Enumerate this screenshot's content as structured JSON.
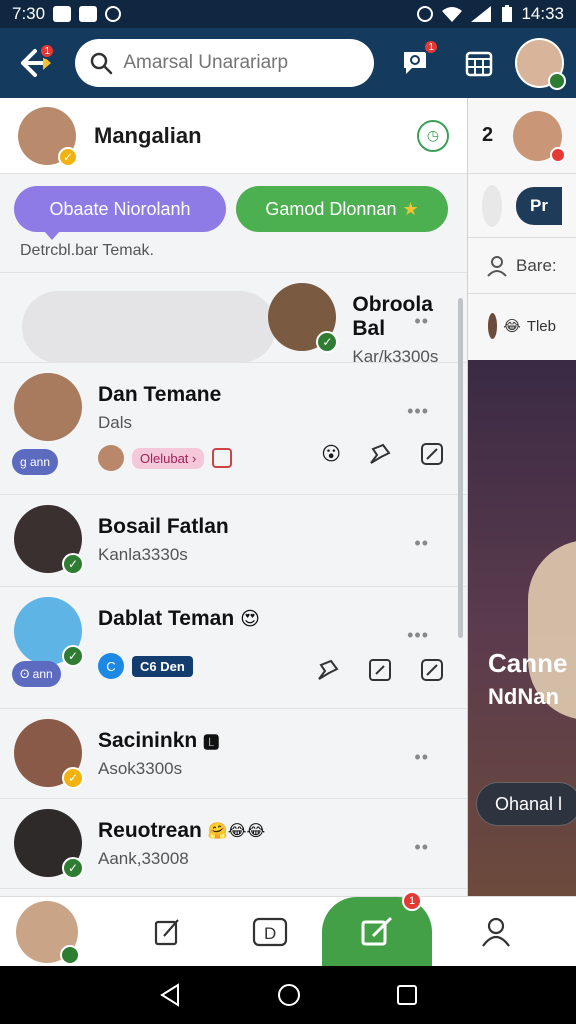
{
  "status_bar": {
    "time": "7:30",
    "right_time": "14:33"
  },
  "app_bar": {
    "back_badge": "1",
    "search_placeholder": "Amarsal Unarariarp",
    "chat_badge": "1"
  },
  "main": {
    "profile_title": "Mangalian",
    "pills": [
      "Obaate Niorolanh",
      "Gamod Dlonnan"
    ],
    "pill_star": "★",
    "section_label": "Detrcbl.bar Temak.",
    "chats": [
      {
        "name": "Obroola Bal",
        "sub": "Kar/k3300s",
        "check": "✓",
        "more": "••"
      },
      {
        "name": "Dan Temane",
        "sub": "Dals",
        "more": "•••",
        "side_pill": "g ann",
        "tag": "Olelubat ›"
      },
      {
        "name": "Bosail Fatlan",
        "sub": "Kanla3330s",
        "check": "✓",
        "more": "••"
      },
      {
        "name": "Dablat Teman",
        "emoji": "😍",
        "check": "✓",
        "more": "•••",
        "side_pill": "ʘ ann",
        "round_icon": "C",
        "tag": "C6 Den"
      },
      {
        "name": "Sacininkn",
        "emoji": "🅻",
        "sub": "Asok3300s",
        "check": "✓",
        "more": "••"
      },
      {
        "name": "Reuotrean",
        "emoji": "🤗😂😂",
        "sub": "Aank,33008",
        "check": "✓",
        "more": "••"
      }
    ]
  },
  "right_panel": {
    "number": "2",
    "button": "Pr",
    "row3": "Bare:",
    "row4": "Tleb",
    "caption1": "Canne",
    "caption2": "NdNan",
    "hero_button": "Ohanal l"
  },
  "bottom_nav": {
    "compose_badge": "1"
  },
  "colors": {
    "app_bar": "#143a5e",
    "accent_green": "#4caf50",
    "accent_purple": "#8e7be6",
    "badge_red": "#e53935"
  },
  "icons": [
    "back-arrow-icon",
    "search-icon",
    "chat-bubble-icon",
    "calendar-grid-icon",
    "clock-icon",
    "star-icon",
    "pin-icon",
    "edit-square-icon",
    "compose-icon",
    "profile-icon",
    "home-circle-icon",
    "back-triangle-icon",
    "recents-square-icon"
  ]
}
